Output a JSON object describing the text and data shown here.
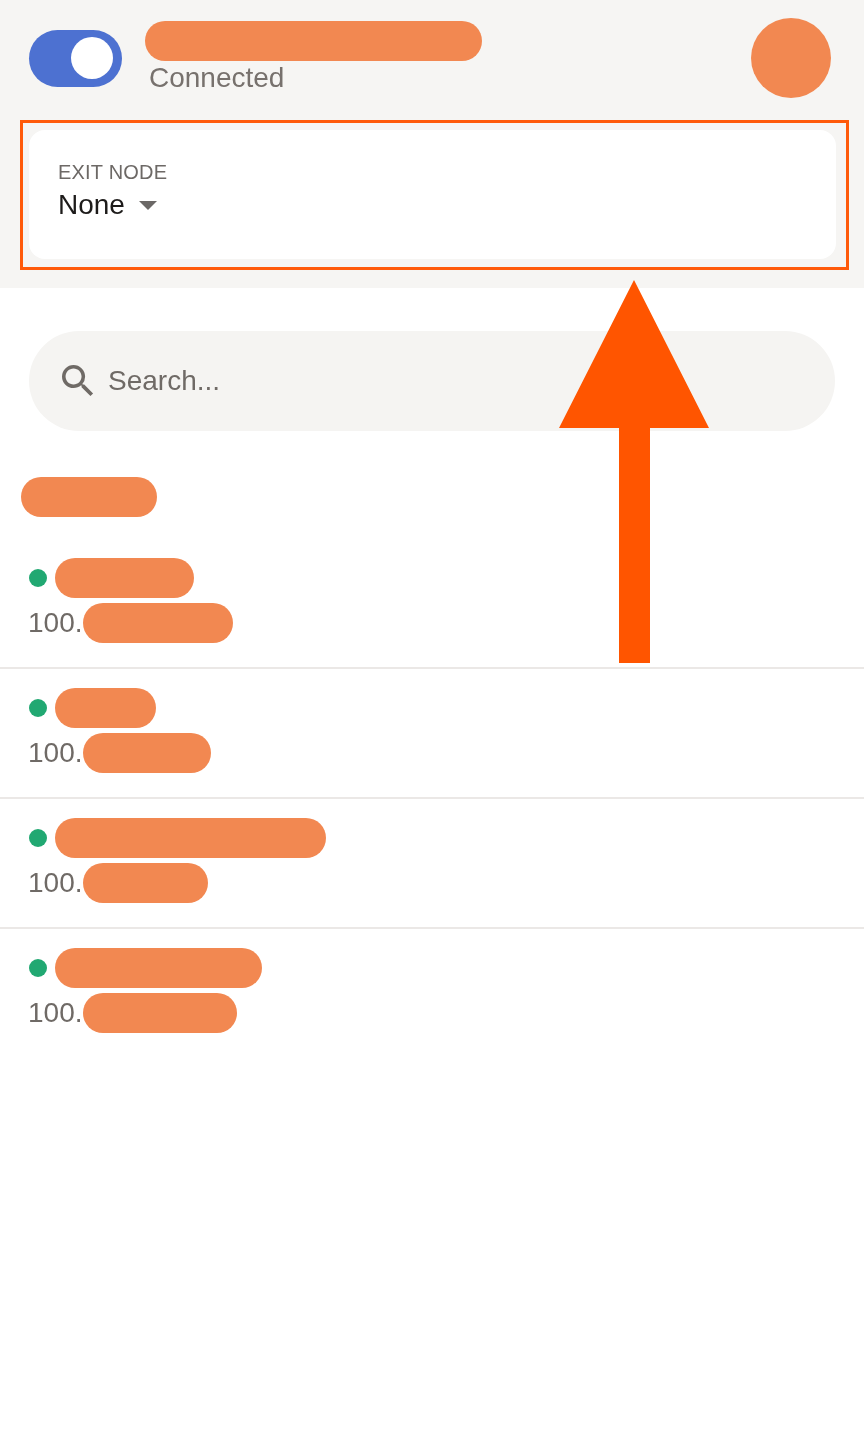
{
  "header": {
    "toggle": {
      "on": true
    },
    "name_redacted": true,
    "status": "Connected",
    "avatar_redacted": true
  },
  "exit_node": {
    "label": "EXIT NODE",
    "value": "None",
    "highlighted": true
  },
  "search": {
    "placeholder": "Search..."
  },
  "device_group": {
    "title_redacted": true,
    "devices": [
      {
        "online": true,
        "name_redacted": true,
        "address": "100.",
        "address_redacted": true
      },
      {
        "online": true,
        "name_redacted": true,
        "address": "100.",
        "address_redacted": true
      },
      {
        "online": true,
        "name_redacted": true,
        "address": "100.",
        "address_redacted": true
      },
      {
        "online": true,
        "name_redacted": true,
        "address": "100.",
        "address_redacted": true
      }
    ]
  },
  "annotation_arrow": true
}
